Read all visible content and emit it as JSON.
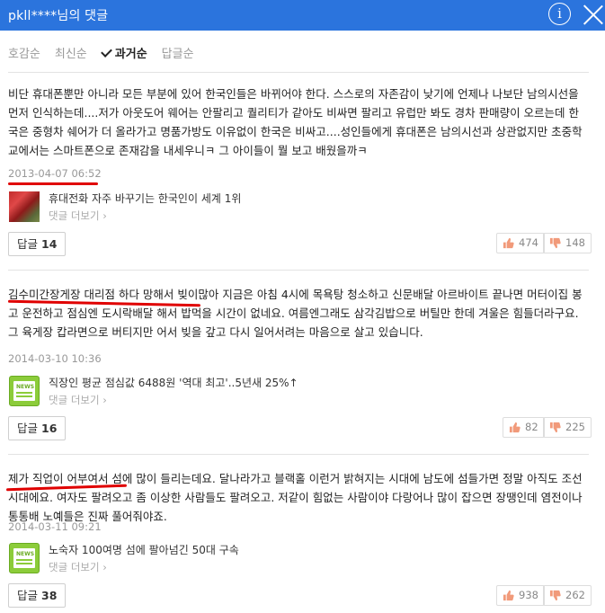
{
  "header": {
    "title": "pkll****님의 댓글",
    "info_symbol": "i"
  },
  "sort": {
    "tabs": [
      {
        "label": "호감순"
      },
      {
        "label": "최신순"
      },
      {
        "label": "과거순"
      },
      {
        "label": "답글순"
      }
    ],
    "active_tab": "과거순"
  },
  "comments": [
    {
      "text": "비단 휴대폰뿐만 아니라 모든 부분에 있어 한국인들은 바뀌어야 한다. 스스로의 자존감이 낮기에 언제나 나보단 남의시선을 먼저 인식하는데....저가 아웃도어 웨어는 안팔리고 퀄리티가 같아도 비싸면 팔리고 유럽만 봐도 경차 판매량이 오르는데 한국은 중형차 쉐어가 더 올라가고 명품가방도 이유없이 한국은 비싸고....성인들에게 휴대폰은 남의시선과 상관없지만 초중학교에서는 스마트폰으로 존재감을 내세우니ㅋ 그 아이들이 뭘 보고 배웠을까ㅋ",
      "date": "2013-04-07 06:52",
      "news_title": "휴대전화 자주 바꾸기는 한국인이 세계 1위",
      "news_more": "댓글 더보기",
      "reply_label": "답글",
      "reply_count": "14",
      "likes": "474",
      "dislikes": "148"
    },
    {
      "text": "김수미간장게장 대리점 하다 망해서 빚이많아 지금은 아침 4시에 목욕탕 청소하고 신문배달 아르바이트 끝나면 머터이집 봉고 운전하고 점심엔 도시락배달 해서 밥먹을 시간이 없네요. 여름엔그래도 삼각김밥으로 버틸만 한데 겨울은 힘들더라구요. 그 육게장 캅라면으로 버티지만 어서 빚을 갚고 다시 일어서려는 마음으로 살고 있습니다.",
      "date": "2014-03-10 10:36",
      "news_title": "직장인 평균 점심값 6488원 '역대 최고'..5년새 25%↑",
      "news_more": "댓글 더보기",
      "reply_label": "답글",
      "reply_count": "16",
      "likes": "82",
      "dislikes": "225"
    },
    {
      "text": "제가 직업이 어부여서 섬에 많이 들리는데요. 달나라가고 블랙홀 이런거 밝혀지는 시대에 남도에 섬들가면 정말 아직도 조선시대에요. 여자도 팔려오고 좀 이상한 사람들도 팔려오고. 저같이 힘없는 사람이야 다랑어나 많이 잡으면 장땡인데 염전이나 통통배 노예들은 진짜 풀어줘야죠.",
      "date": "2014-03-11 09:21",
      "news_title": "노숙자 100여명 섬에 팔아넘긴 50대 구속",
      "news_more": "댓글 더보기",
      "reply_label": "답글",
      "reply_count": "38",
      "likes": "938",
      "dislikes": "262"
    }
  ],
  "colors": {
    "header_bg": "#2b74dd",
    "underline": "#e00000",
    "news_icon": "#8ccc3a"
  },
  "icons": {
    "news_label": "NEWS"
  }
}
